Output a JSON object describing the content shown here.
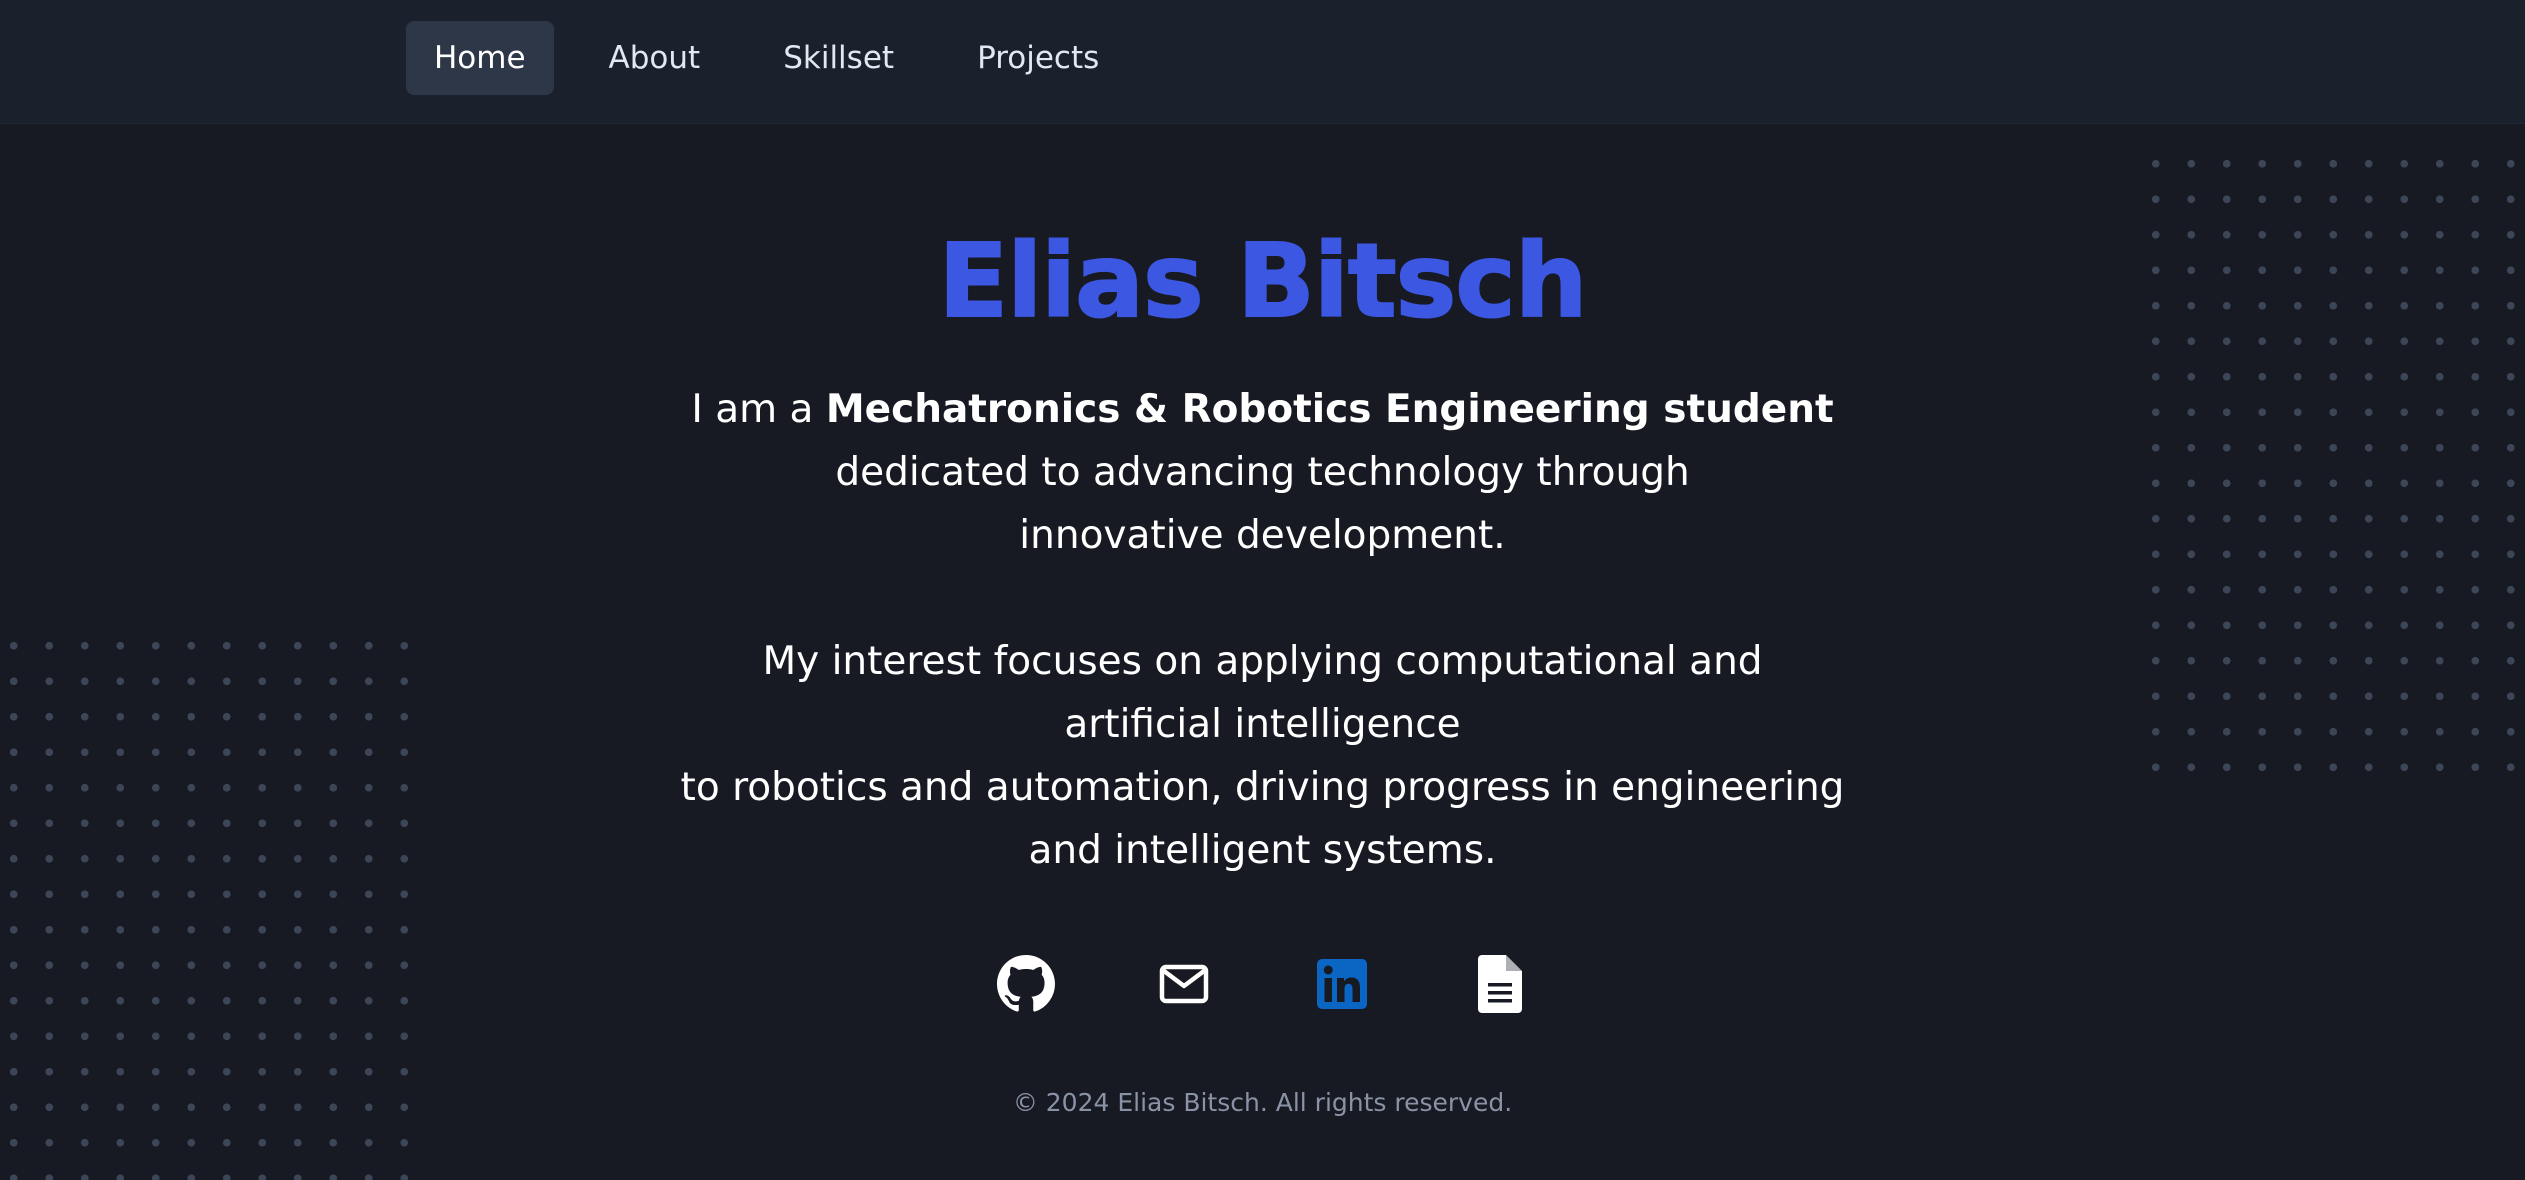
{
  "nav": {
    "items": [
      {
        "label": "Home",
        "active": true
      },
      {
        "label": "About",
        "active": false
      },
      {
        "label": "Skillset",
        "active": false
      },
      {
        "label": "Projects",
        "active": false
      }
    ]
  },
  "hero": {
    "name": "Elias Bitsch",
    "intro_prefix": "I am a ",
    "intro_bold": "Mechatronics & Robotics Engineering student",
    "line2": "dedicated to advancing technology through",
    "line3": "innovative development.",
    "line4": "My interest focuses on applying computational and",
    "line5": "artificial intelligence",
    "line6": "to robotics and automation, driving progress in engineering",
    "line7": "and intelligent systems."
  },
  "social": [
    {
      "icon": "github-icon"
    },
    {
      "icon": "mail-icon"
    },
    {
      "icon": "linkedin-icon"
    },
    {
      "icon": "document-icon"
    }
  ],
  "footer": {
    "text": "© 2024 Elias Bitsch. All rights reserved."
  },
  "colors": {
    "background": "#171923",
    "navbar": "#1a202c",
    "accent": "#3c57e2",
    "linkedin": "#0a66c2"
  }
}
